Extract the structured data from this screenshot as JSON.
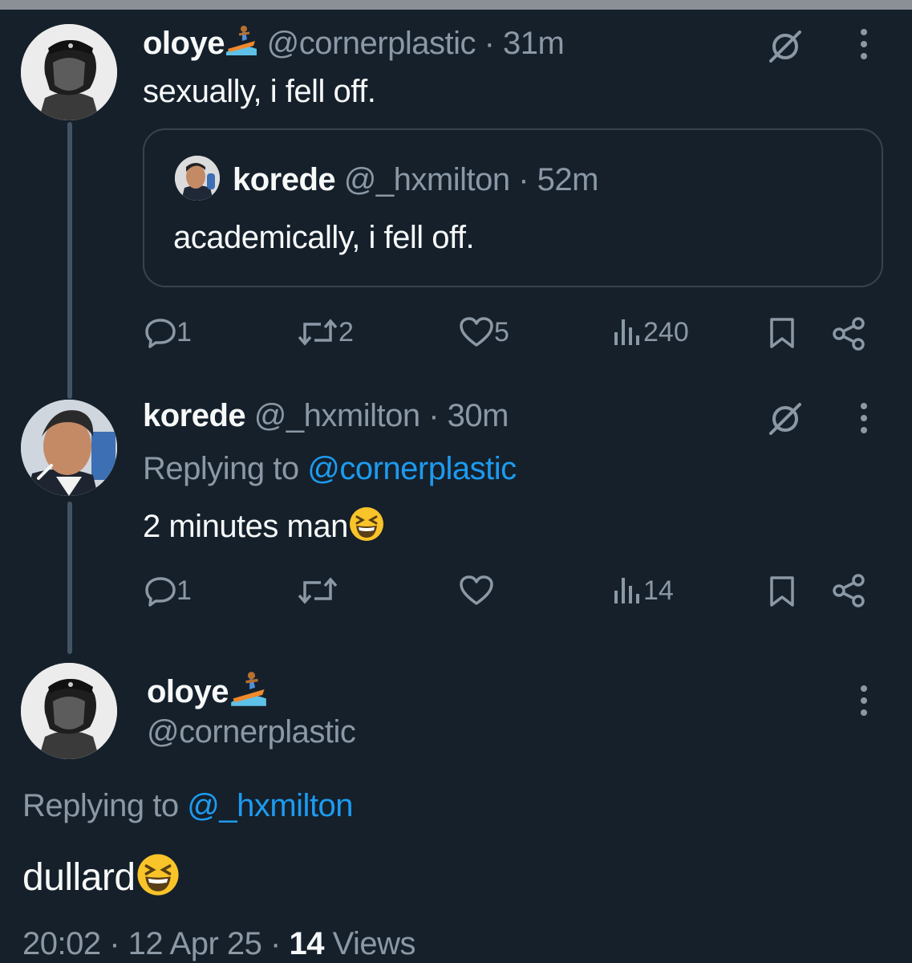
{
  "tweet1": {
    "name": "oloye",
    "handle": "@cornerplastic",
    "time": "· 31m",
    "text": "sexually, i fell off.",
    "quoted": {
      "name": "korede",
      "handle": "@_hxmilton",
      "time": "· 52m",
      "text": "academically, i fell off."
    },
    "actions": {
      "replies": "1",
      "reposts": "2",
      "likes": "5",
      "views": "240"
    }
  },
  "tweet2": {
    "name": "korede",
    "handle": "@_hxmilton",
    "time": "· 30m",
    "replying_prefix": "Replying to",
    "replying_to": "@cornerplastic",
    "text": "2 minutes man",
    "actions": {
      "replies": "1",
      "reposts": "",
      "likes": "",
      "views": "14"
    }
  },
  "tweet3": {
    "name": "oloye",
    "handle": "@cornerplastic",
    "replying_prefix": "Replying to",
    "replying_to": "@_hxmilton",
    "text": "dullard",
    "timestamp": "20:02 · 12 Apr 25 ·",
    "views_count": "14",
    "views_label": "Views"
  },
  "icons": {
    "surfer": "surfer-emoji",
    "laugh": "grinning-squinting-face-emoji",
    "reply": "speech-bubble-icon",
    "repost": "repost-arrows-icon",
    "like": "heart-icon",
    "views": "bar-chart-icon",
    "bookmark": "bookmark-icon",
    "share": "share-nodes-icon",
    "grok": "slashed-circle-icon",
    "more": "vertical-dots-icon"
  },
  "colors": {
    "background": "#15202b",
    "link": "#1d9bf0",
    "muted": "#8b98a5",
    "text": "#f7f9f9"
  }
}
